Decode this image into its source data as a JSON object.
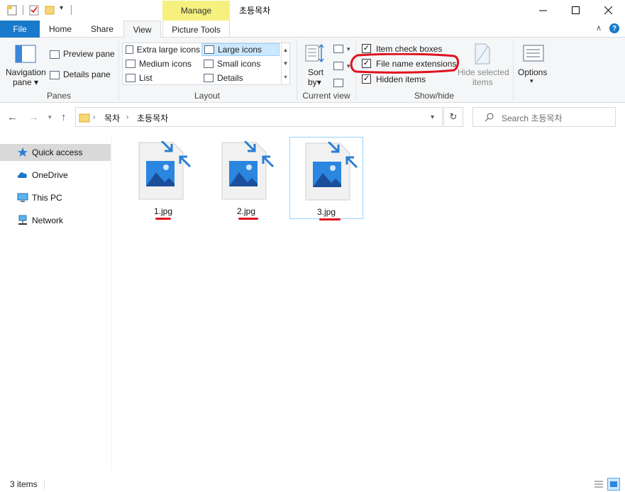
{
  "window": {
    "title": "초등목차",
    "manage_label": "Manage"
  },
  "tabs": {
    "file": "File",
    "home": "Home",
    "share": "Share",
    "view": "View",
    "picture_tools": "Picture Tools"
  },
  "ribbon": {
    "panes": {
      "group": "Panes",
      "navigation_pane": "Navigation",
      "navigation_pane_2": "pane",
      "preview_pane": "Preview pane",
      "details_pane": "Details pane"
    },
    "layout": {
      "group": "Layout",
      "items": [
        "Extra large icons",
        "Large icons",
        "Medium icons",
        "Small icons",
        "List",
        "Details"
      ],
      "selected": "Large icons"
    },
    "current_view": {
      "group": "Current view",
      "sort": "Sort",
      "sort_2": "by"
    },
    "show_hide": {
      "group": "Show/hide",
      "item_check_boxes": "Item check boxes",
      "item_check_boxes_checked": true,
      "file_name_extensions": "File name extensions",
      "file_name_extensions_checked": true,
      "hidden_items": "Hidden items",
      "hidden_items_checked": true,
      "hide_selected": "Hide selected",
      "hide_selected_2": "items"
    },
    "options": "Options"
  },
  "address": {
    "crumbs": [
      "목차",
      "초등목차"
    ],
    "search_placeholder": "Search 초등목차"
  },
  "navpane": {
    "items": [
      "Quick access",
      "OneDrive",
      "This PC",
      "Network"
    ],
    "selected": "Quick access"
  },
  "files": [
    {
      "name": "1.jpg"
    },
    {
      "name": "2.jpg"
    },
    {
      "name": "3.jpg"
    }
  ],
  "status": {
    "text": "3 items"
  },
  "colors": {
    "accent": "#1979ca",
    "manage": "#f6f07f",
    "selection": "#cce8ff",
    "annotation": "#e0101e"
  }
}
